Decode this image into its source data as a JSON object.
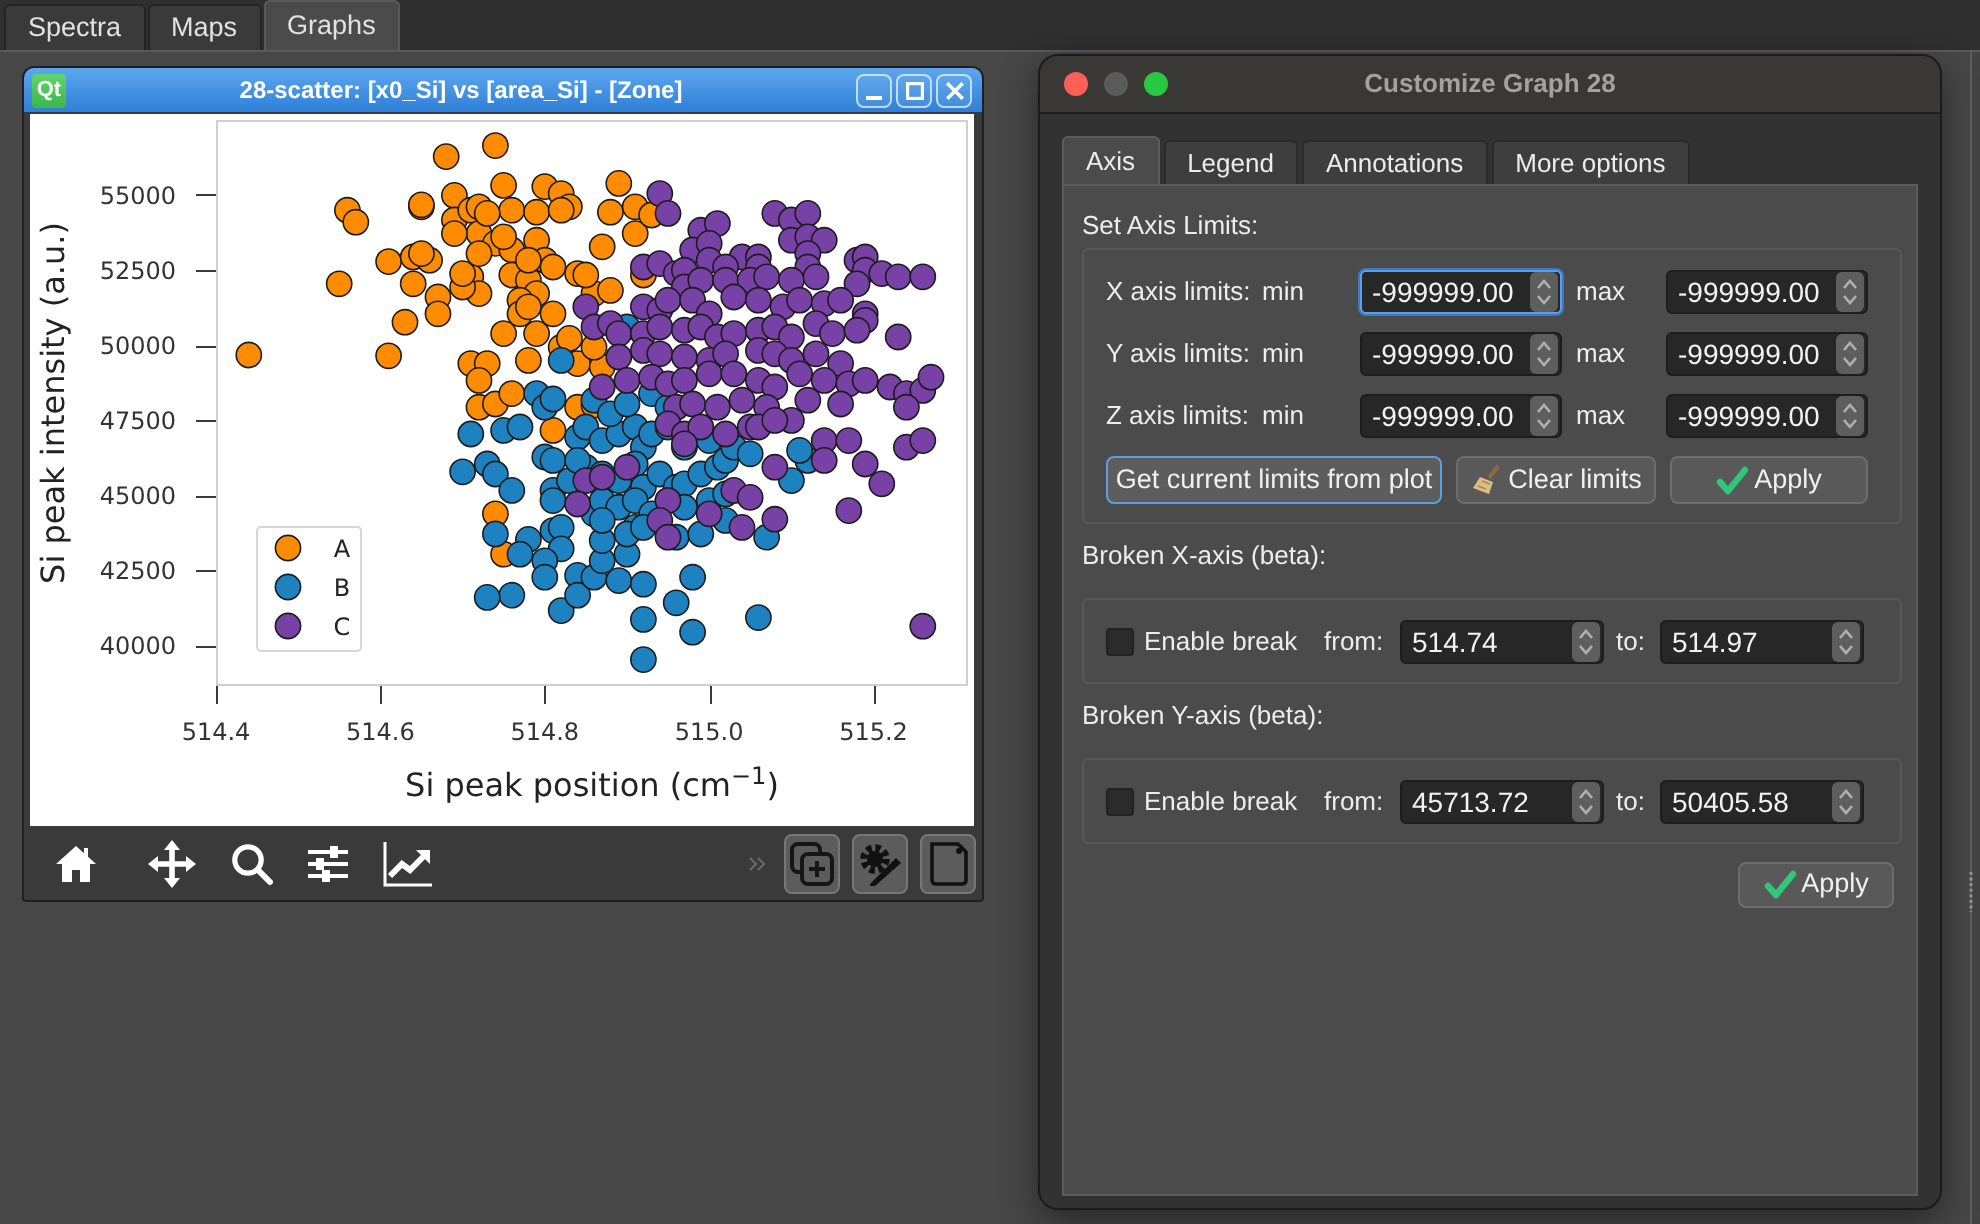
{
  "main_tabs": [
    {
      "label": "Spectra",
      "selected": false
    },
    {
      "label": "Maps",
      "selected": false
    },
    {
      "label": "Graphs",
      "selected": true
    }
  ],
  "graph_window": {
    "logo": "Qt",
    "title": "28-scatter: [x0_Si] vs [area_Si] - [Zone]",
    "chart_data": {
      "type": "scatter",
      "xlabel": "Si peak position (cm$^{−1}$)",
      "ylabel": "Si peak intensity (a.u.)",
      "xlim": [
        514.4,
        515.315
      ],
      "ylim": [
        38650,
        57490
      ],
      "xticks": [
        {
          "value": 514.4,
          "label": "514.4"
        },
        {
          "value": 514.6,
          "label": "514.6"
        },
        {
          "value": 514.8,
          "label": "514.8"
        },
        {
          "value": 515.0,
          "label": "515.0"
        },
        {
          "value": 515.2,
          "label": "515.2"
        }
      ],
      "yticks": [
        {
          "value": 40000,
          "label": "40000"
        },
        {
          "value": 42500,
          "label": "42500"
        },
        {
          "value": 45000,
          "label": "45000"
        },
        {
          "value": 47500,
          "label": "47500"
        },
        {
          "value": 50000,
          "label": "50000"
        },
        {
          "value": 52500,
          "label": "52500"
        },
        {
          "value": 55000,
          "label": "55000"
        }
      ],
      "legend": true,
      "series": [
        {
          "name": "A",
          "color": "#ff8c00",
          "x": [
            514.44,
            514.56,
            514.57,
            514.55,
            514.61,
            514.61,
            514.63,
            514.64,
            514.64,
            514.65,
            514.65,
            514.66,
            514.65,
            514.67,
            514.67,
            514.68,
            514.69,
            514.69,
            514.71,
            514.72,
            514.74,
            514.75,
            514.71,
            514.72,
            514.7,
            514.72,
            514.74,
            514.76,
            514.75,
            514.76,
            514.79,
            514.8,
            514.82,
            514.83,
            514.79,
            514.8,
            514.81,
            514.76,
            514.78,
            514.79,
            514.77,
            514.77,
            514.78,
            514.81,
            514.75,
            514.79,
            514.71,
            514.73,
            514.72,
            514.72,
            514.74,
            514.76,
            514.78,
            514.82,
            514.83,
            514.84,
            514.87,
            514.86,
            514.84,
            514.86,
            514.81,
            514.86,
            514.88,
            514.87,
            514.89,
            514.91,
            514.91,
            514.93,
            514.92,
            514.74,
            514.75,
            514.88,
            514.84,
            514.85,
            514.69,
            514.7,
            514.72,
            514.78,
            514.82,
            514.73
          ],
          "values": [
            49670,
            54490,
            54090,
            52040,
            52780,
            49640,
            50760,
            52930,
            52040,
            54600,
            54670,
            52820,
            53040,
            51600,
            51040,
            56270,
            54980,
            54160,
            54490,
            54600,
            56640,
            55310,
            52270,
            51710,
            51930,
            53710,
            53380,
            53160,
            53600,
            54490,
            54420,
            55270,
            55040,
            54600,
            53490,
            52820,
            52600,
            52330,
            52160,
            51710,
            51490,
            51040,
            51270,
            51040,
            50380,
            50380,
            49380,
            49380,
            48820,
            47930,
            48040,
            48380,
            49490,
            49930,
            50220,
            49380,
            49270,
            49930,
            47930,
            48000,
            47160,
            51710,
            51820,
            53270,
            55380,
            54600,
            53710,
            54330,
            52330,
            44380,
            43040,
            54420,
            52380,
            52330,
            53710,
            52380,
            53040,
            52820,
            54490,
            54380
          ]
        },
        {
          "name": "B",
          "color": "#1f82c0",
          "x": [
            514.71,
            514.7,
            514.73,
            514.74,
            514.76,
            514.75,
            514.77,
            514.74,
            514.78,
            514.77,
            514.76,
            514.73,
            514.79,
            514.8,
            514.81,
            514.82,
            514.9,
            514.8,
            514.81,
            514.81,
            514.81,
            514.81,
            514.82,
            514.82,
            514.8,
            514.8,
            514.82,
            514.84,
            514.84,
            514.86,
            514.87,
            514.87,
            514.89,
            514.9,
            514.91,
            514.92,
            514.92,
            514.92,
            514.96,
            514.98,
            514.98,
            515.06,
            514.84,
            514.85,
            514.87,
            514.89,
            514.91,
            514.92,
            514.93,
            514.95,
            514.97,
            514.85,
            514.87,
            514.89,
            514.91,
            514.92,
            514.94,
            514.96,
            514.97,
            514.99,
            515.01,
            515.02,
            514.86,
            514.87,
            514.89,
            514.91,
            514.93,
            514.95,
            514.97,
            515.0,
            515.02,
            514.87,
            514.9,
            514.92,
            514.96,
            514.99,
            515.02,
            515.07,
            514.86,
            514.88,
            514.9,
            514.93,
            514.95,
            515.03,
            515.05,
            515.1,
            515.12,
            515.11,
            514.83,
            514.84,
            515.0
          ],
          "values": [
            47040,
            45780,
            46040,
            45710,
            45160,
            47160,
            47270,
            43710,
            43530,
            43040,
            41670,
            41600,
            48380,
            47930,
            48200,
            49490,
            50600,
            46270,
            46160,
            45160,
            44820,
            43820,
            43930,
            43220,
            42820,
            42270,
            41160,
            42330,
            41670,
            42270,
            42820,
            43490,
            42160,
            43040,
            43930,
            42040,
            40870,
            39530,
            41420,
            40440,
            42270,
            40930,
            46930,
            47270,
            46820,
            47040,
            47270,
            46600,
            47040,
            47270,
            46600,
            45930,
            45710,
            45490,
            46040,
            45270,
            45710,
            45270,
            45380,
            45710,
            45930,
            46160,
            44380,
            44820,
            44600,
            44820,
            44380,
            44820,
            44600,
            44820,
            45040,
            44160,
            43710,
            43930,
            43600,
            43710,
            44160,
            43600,
            48160,
            47710,
            48040,
            48380,
            47930,
            46600,
            46380,
            45490,
            46160,
            46490,
            45490,
            46160,
            46820
          ]
        },
        {
          "name": "C",
          "color": "#7841a5",
          "x": [
            514.94,
            514.95,
            514.99,
            515.01,
            514.98,
            515.0,
            515.08,
            515.1,
            515.12,
            515.1,
            515.12,
            515.14,
            515.04,
            515.06,
            515.06,
            515.12,
            515.12,
            514.92,
            514.94,
            514.96,
            514.97,
            515.0,
            515.02,
            514.97,
            514.99,
            515.02,
            515.05,
            515.07,
            515.1,
            515.13,
            515.18,
            515.19,
            515.19,
            515.21,
            515.23,
            515.26,
            515.18,
            514.92,
            514.94,
            514.95,
            514.98,
            515.0,
            515.03,
            515.06,
            515.09,
            515.11,
            515.14,
            515.16,
            515.19,
            515.19,
            514.85,
            514.86,
            514.88,
            514.89,
            514.92,
            514.94,
            514.97,
            514.99,
            515.01,
            515.03,
            515.06,
            515.08,
            515.1,
            515.13,
            515.15,
            515.18,
            515.23,
            514.89,
            514.92,
            514.94,
            514.97,
            515.0,
            515.02,
            515.06,
            515.08,
            515.1,
            515.13,
            515.16,
            514.87,
            514.9,
            514.93,
            514.95,
            514.97,
            515.0,
            515.03,
            515.06,
            515.08,
            515.11,
            515.14,
            515.17,
            515.19,
            515.22,
            515.24,
            514.96,
            514.98,
            515.01,
            515.04,
            515.07,
            515.1,
            515.12,
            515.16,
            515.26,
            515.27,
            515.24,
            514.95,
            514.97,
            514.99,
            515.02,
            515.05,
            515.06,
            515.08,
            514.97,
            515.14,
            515.14,
            515.17,
            515.24,
            515.26,
            515.19,
            515.21,
            514.85,
            514.87,
            514.9,
            514.84,
            514.95,
            515.03,
            515.05,
            515.08,
            514.94,
            514.95,
            515.0,
            515.04,
            515.08,
            515.17,
            515.26
          ],
          "values": [
            55040,
            54380,
            53820,
            54040,
            53160,
            53380,
            54380,
            54160,
            54380,
            53490,
            53600,
            53490,
            52930,
            52930,
            52600,
            53040,
            52600,
            52600,
            52710,
            52380,
            52490,
            52820,
            52600,
            51930,
            52160,
            52160,
            52160,
            52270,
            52160,
            52270,
            52820,
            52930,
            52490,
            52380,
            52270,
            52270,
            52040,
            51270,
            51160,
            51490,
            51490,
            51040,
            51600,
            51490,
            51270,
            51490,
            51380,
            51490,
            51040,
            50820,
            51270,
            50600,
            50710,
            50380,
            50380,
            50600,
            50490,
            50600,
            50270,
            50380,
            50490,
            50600,
            50270,
            50710,
            50380,
            50490,
            50270,
            49600,
            49820,
            49710,
            49600,
            49490,
            49710,
            49820,
            49710,
            49490,
            49710,
            49380,
            48600,
            48820,
            48930,
            48710,
            48820,
            49040,
            49040,
            48820,
            48600,
            49040,
            48820,
            48710,
            48820,
            48600,
            48380,
            47930,
            48040,
            47930,
            48160,
            47930,
            47490,
            48160,
            48040,
            48490,
            48930,
            47930,
            47380,
            47040,
            47270,
            47040,
            47270,
            47270,
            47490,
            46710,
            46820,
            46160,
            46820,
            46600,
            46820,
            46040,
            45380,
            45490,
            45600,
            45930,
            44710,
            44820,
            45160,
            44930,
            45930,
            44160,
            43600,
            44380,
            43930,
            44200,
            44490,
            40640
          ]
        }
      ]
    }
  },
  "dialog": {
    "title": "Customize Graph 28",
    "tabs": [
      {
        "label": "Axis",
        "selected": true
      },
      {
        "label": "Legend",
        "selected": false
      },
      {
        "label": "Annotations",
        "selected": false
      },
      {
        "label": "More options",
        "selected": false
      }
    ],
    "axis_limits": {
      "heading": "Set Axis Limits:",
      "rows": [
        {
          "label": "X axis limits:",
          "min_label": "min",
          "min": {
            "value": "-999999.00",
            "focused": true
          },
          "max_label": "max",
          "max": {
            "value": "-999999.00",
            "focused": false
          }
        },
        {
          "label": "Y axis limits:",
          "min_label": "min",
          "min": {
            "value": "-999999.00",
            "focused": false
          },
          "max_label": "max",
          "max": {
            "value": "-999999.00",
            "focused": false
          }
        },
        {
          "label": "Z axis limits:",
          "min_label": "min",
          "min": {
            "value": "-999999.00",
            "focused": false
          },
          "max_label": "max",
          "max": {
            "value": "-999999.00",
            "focused": false
          }
        }
      ],
      "buttons": [
        {
          "kind": "plain",
          "label": "Get current limits from plot",
          "focused": true
        },
        {
          "kind": "clear",
          "label": "Clear limits",
          "focused": false
        },
        {
          "kind": "apply",
          "label": "Apply",
          "focused": false
        }
      ]
    },
    "broken_axes": [
      {
        "heading": "Broken X-axis (beta):",
        "checkbox": {
          "label": "Enable break",
          "checked": false
        },
        "from_label": "from:",
        "from": {
          "value": "514.74",
          "focused": false
        },
        "to_label": "to:",
        "to": {
          "value": "514.97",
          "focused": false
        }
      },
      {
        "heading": "Broken Y-axis (beta):",
        "checkbox": {
          "label": "Enable break",
          "checked": false
        },
        "from_label": "from:",
        "from": {
          "value": "45713.72",
          "focused": false
        },
        "to_label": "to:",
        "to": {
          "value": "50405.58",
          "focused": false
        }
      }
    ],
    "apply_button": {
      "kind": "apply",
      "label": "Apply",
      "focused": false
    }
  }
}
